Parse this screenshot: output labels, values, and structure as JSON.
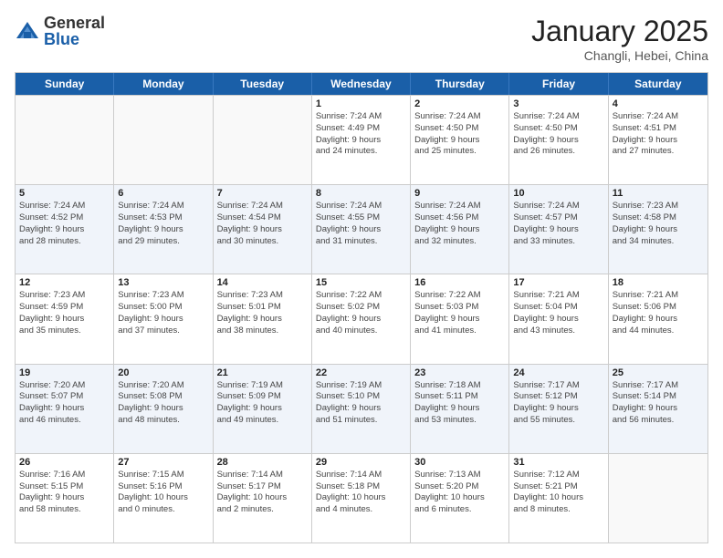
{
  "logo": {
    "general": "General",
    "blue": "Blue"
  },
  "header": {
    "month": "January 2025",
    "location": "Changli, Hebei, China"
  },
  "weekdays": [
    "Sunday",
    "Monday",
    "Tuesday",
    "Wednesday",
    "Thursday",
    "Friday",
    "Saturday"
  ],
  "rows": [
    [
      {
        "day": "",
        "lines": [],
        "empty": true
      },
      {
        "day": "",
        "lines": [],
        "empty": true
      },
      {
        "day": "",
        "lines": [],
        "empty": true
      },
      {
        "day": "1",
        "lines": [
          "Sunrise: 7:24 AM",
          "Sunset: 4:49 PM",
          "Daylight: 9 hours",
          "and 24 minutes."
        ],
        "empty": false
      },
      {
        "day": "2",
        "lines": [
          "Sunrise: 7:24 AM",
          "Sunset: 4:50 PM",
          "Daylight: 9 hours",
          "and 25 minutes."
        ],
        "empty": false
      },
      {
        "day": "3",
        "lines": [
          "Sunrise: 7:24 AM",
          "Sunset: 4:50 PM",
          "Daylight: 9 hours",
          "and 26 minutes."
        ],
        "empty": false
      },
      {
        "day": "4",
        "lines": [
          "Sunrise: 7:24 AM",
          "Sunset: 4:51 PM",
          "Daylight: 9 hours",
          "and 27 minutes."
        ],
        "empty": false
      }
    ],
    [
      {
        "day": "5",
        "lines": [
          "Sunrise: 7:24 AM",
          "Sunset: 4:52 PM",
          "Daylight: 9 hours",
          "and 28 minutes."
        ],
        "empty": false
      },
      {
        "day": "6",
        "lines": [
          "Sunrise: 7:24 AM",
          "Sunset: 4:53 PM",
          "Daylight: 9 hours",
          "and 29 minutes."
        ],
        "empty": false
      },
      {
        "day": "7",
        "lines": [
          "Sunrise: 7:24 AM",
          "Sunset: 4:54 PM",
          "Daylight: 9 hours",
          "and 30 minutes."
        ],
        "empty": false
      },
      {
        "day": "8",
        "lines": [
          "Sunrise: 7:24 AM",
          "Sunset: 4:55 PM",
          "Daylight: 9 hours",
          "and 31 minutes."
        ],
        "empty": false
      },
      {
        "day": "9",
        "lines": [
          "Sunrise: 7:24 AM",
          "Sunset: 4:56 PM",
          "Daylight: 9 hours",
          "and 32 minutes."
        ],
        "empty": false
      },
      {
        "day": "10",
        "lines": [
          "Sunrise: 7:24 AM",
          "Sunset: 4:57 PM",
          "Daylight: 9 hours",
          "and 33 minutes."
        ],
        "empty": false
      },
      {
        "day": "11",
        "lines": [
          "Sunrise: 7:23 AM",
          "Sunset: 4:58 PM",
          "Daylight: 9 hours",
          "and 34 minutes."
        ],
        "empty": false
      }
    ],
    [
      {
        "day": "12",
        "lines": [
          "Sunrise: 7:23 AM",
          "Sunset: 4:59 PM",
          "Daylight: 9 hours",
          "and 35 minutes."
        ],
        "empty": false
      },
      {
        "day": "13",
        "lines": [
          "Sunrise: 7:23 AM",
          "Sunset: 5:00 PM",
          "Daylight: 9 hours",
          "and 37 minutes."
        ],
        "empty": false
      },
      {
        "day": "14",
        "lines": [
          "Sunrise: 7:23 AM",
          "Sunset: 5:01 PM",
          "Daylight: 9 hours",
          "and 38 minutes."
        ],
        "empty": false
      },
      {
        "day": "15",
        "lines": [
          "Sunrise: 7:22 AM",
          "Sunset: 5:02 PM",
          "Daylight: 9 hours",
          "and 40 minutes."
        ],
        "empty": false
      },
      {
        "day": "16",
        "lines": [
          "Sunrise: 7:22 AM",
          "Sunset: 5:03 PM",
          "Daylight: 9 hours",
          "and 41 minutes."
        ],
        "empty": false
      },
      {
        "day": "17",
        "lines": [
          "Sunrise: 7:21 AM",
          "Sunset: 5:04 PM",
          "Daylight: 9 hours",
          "and 43 minutes."
        ],
        "empty": false
      },
      {
        "day": "18",
        "lines": [
          "Sunrise: 7:21 AM",
          "Sunset: 5:06 PM",
          "Daylight: 9 hours",
          "and 44 minutes."
        ],
        "empty": false
      }
    ],
    [
      {
        "day": "19",
        "lines": [
          "Sunrise: 7:20 AM",
          "Sunset: 5:07 PM",
          "Daylight: 9 hours",
          "and 46 minutes."
        ],
        "empty": false
      },
      {
        "day": "20",
        "lines": [
          "Sunrise: 7:20 AM",
          "Sunset: 5:08 PM",
          "Daylight: 9 hours",
          "and 48 minutes."
        ],
        "empty": false
      },
      {
        "day": "21",
        "lines": [
          "Sunrise: 7:19 AM",
          "Sunset: 5:09 PM",
          "Daylight: 9 hours",
          "and 49 minutes."
        ],
        "empty": false
      },
      {
        "day": "22",
        "lines": [
          "Sunrise: 7:19 AM",
          "Sunset: 5:10 PM",
          "Daylight: 9 hours",
          "and 51 minutes."
        ],
        "empty": false
      },
      {
        "day": "23",
        "lines": [
          "Sunrise: 7:18 AM",
          "Sunset: 5:11 PM",
          "Daylight: 9 hours",
          "and 53 minutes."
        ],
        "empty": false
      },
      {
        "day": "24",
        "lines": [
          "Sunrise: 7:17 AM",
          "Sunset: 5:12 PM",
          "Daylight: 9 hours",
          "and 55 minutes."
        ],
        "empty": false
      },
      {
        "day": "25",
        "lines": [
          "Sunrise: 7:17 AM",
          "Sunset: 5:14 PM",
          "Daylight: 9 hours",
          "and 56 minutes."
        ],
        "empty": false
      }
    ],
    [
      {
        "day": "26",
        "lines": [
          "Sunrise: 7:16 AM",
          "Sunset: 5:15 PM",
          "Daylight: 9 hours",
          "and 58 minutes."
        ],
        "empty": false
      },
      {
        "day": "27",
        "lines": [
          "Sunrise: 7:15 AM",
          "Sunset: 5:16 PM",
          "Daylight: 10 hours",
          "and 0 minutes."
        ],
        "empty": false
      },
      {
        "day": "28",
        "lines": [
          "Sunrise: 7:14 AM",
          "Sunset: 5:17 PM",
          "Daylight: 10 hours",
          "and 2 minutes."
        ],
        "empty": false
      },
      {
        "day": "29",
        "lines": [
          "Sunrise: 7:14 AM",
          "Sunset: 5:18 PM",
          "Daylight: 10 hours",
          "and 4 minutes."
        ],
        "empty": false
      },
      {
        "day": "30",
        "lines": [
          "Sunrise: 7:13 AM",
          "Sunset: 5:20 PM",
          "Daylight: 10 hours",
          "and 6 minutes."
        ],
        "empty": false
      },
      {
        "day": "31",
        "lines": [
          "Sunrise: 7:12 AM",
          "Sunset: 5:21 PM",
          "Daylight: 10 hours",
          "and 8 minutes."
        ],
        "empty": false
      },
      {
        "day": "",
        "lines": [],
        "empty": true
      }
    ]
  ]
}
